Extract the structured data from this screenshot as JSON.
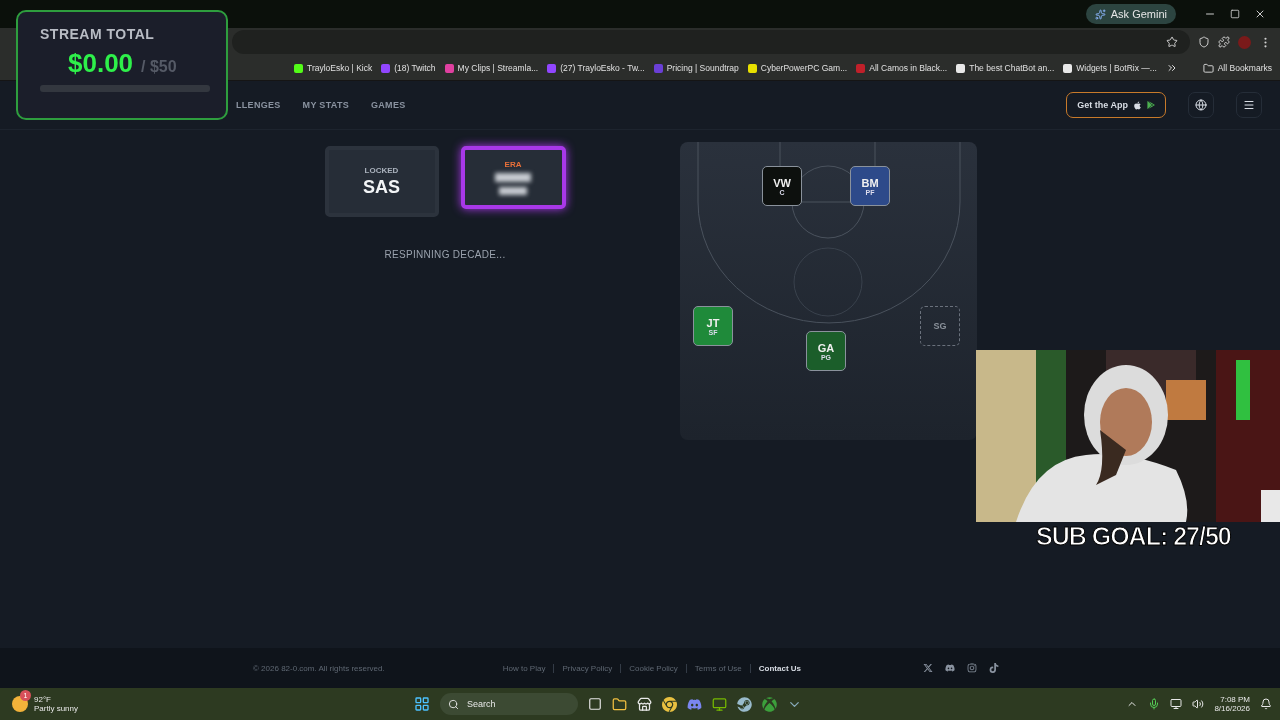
{
  "browser": {
    "ask_gemini": "Ask Gemini",
    "bookmarks": [
      {
        "label": "TrayloEsko | Kick",
        "color": "#53fc18"
      },
      {
        "label": "(18) Twitch",
        "color": "#9146ff"
      },
      {
        "label": "My Clips | Streamla...",
        "color": "#e040a0"
      },
      {
        "label": "(27) TrayloEsko - Tw...",
        "color": "#9146ff"
      },
      {
        "label": "Pricing | Soundtrap",
        "color": "#6a3fd6"
      },
      {
        "label": "CyberPowerPC Gam...",
        "color": "#e8e000"
      },
      {
        "label": "All Camos in Black...",
        "color": "#c0202a"
      },
      {
        "label": "The best ChatBot an...",
        "color": "#e8e8e8"
      },
      {
        "label": "Widgets | BotRix —...",
        "color": "#e8e8e8"
      }
    ],
    "all_bookmarks": "All Bookmarks"
  },
  "overlay": {
    "title": "STREAM TOTAL",
    "amount": "$0.00",
    "goal": "/ $50",
    "level": 0
  },
  "site": {
    "nav": [
      "LLENGES",
      "MY STATS",
      "GAMES"
    ],
    "get_app": "Get the App"
  },
  "cards": [
    {
      "kind": "locked",
      "label": "LOCKED",
      "value": "SAS",
      "selected": false
    },
    {
      "kind": "spinning",
      "label": "ERA",
      "selected": true
    }
  ],
  "status": "RESPINNING DECADE...",
  "court": {
    "slots": [
      {
        "kind": "filled",
        "initials": "VW",
        "position": "C",
        "color": "#0d100e"
      },
      {
        "kind": "filled",
        "initials": "BM",
        "position": "PF",
        "color": "#2d4a8a"
      },
      {
        "kind": "filled",
        "initials": "JT",
        "position": "SF",
        "color": "#1f8a3a"
      },
      {
        "kind": "filled",
        "initials": "GA",
        "position": "PG",
        "color": "#1b5e2a"
      },
      {
        "kind": "empty",
        "position": "SG"
      }
    ]
  },
  "webcam": {
    "sub_goal": "SUB GOAL: 27/50"
  },
  "footer": {
    "copyright": "© 2026 82-0.com. All rights reserved.",
    "links": [
      {
        "label": "How to Play",
        "highlighted": false
      },
      {
        "label": "Privacy Policy",
        "highlighted": false
      },
      {
        "label": "Cookie Policy",
        "highlighted": false
      },
      {
        "label": "Terms of Use",
        "highlighted": false
      },
      {
        "label": "Contact Us",
        "highlighted": true
      }
    ]
  },
  "taskbar": {
    "badge": "1",
    "temperature": "92°F",
    "condition": "Partly sunny",
    "search": "Search",
    "time": "7:08 PM",
    "date": "8/16/2026"
  }
}
